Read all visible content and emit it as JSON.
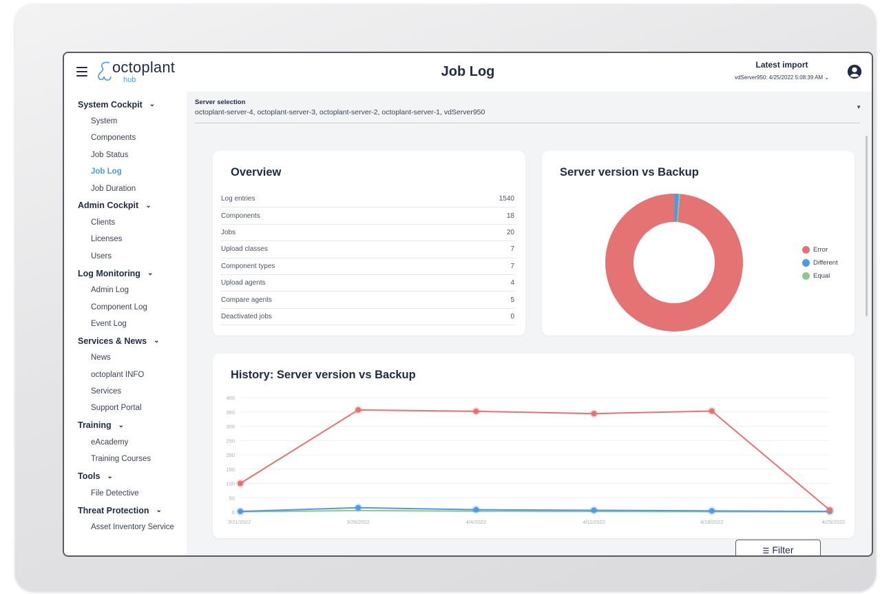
{
  "header": {
    "logo_text": "octoplant",
    "logo_sub": "hub",
    "page_title": "Job Log",
    "latest_import_label": "Latest import",
    "latest_import_value": "vdServer950: 4/25/2022 5:08:39 AM ⌄",
    "user_icon": "account-circle-icon",
    "menu_icon": "hamburger-menu-icon"
  },
  "sidebar": {
    "sections": [
      {
        "label": "System Cockpit",
        "items": [
          "System",
          "Components",
          "Job Status",
          "Job Log",
          "Job Duration"
        ]
      },
      {
        "label": "Admin Cockpit",
        "items": [
          "Clients",
          "Licenses",
          "Users"
        ]
      },
      {
        "label": "Log Monitoring",
        "items": [
          "Admin Log",
          "Component Log",
          "Event Log"
        ]
      },
      {
        "label": "Services & News",
        "items": [
          "News",
          "octoplant INFO",
          "Services",
          "Support Portal"
        ]
      },
      {
        "label": "Training",
        "items": [
          "eAcademy",
          "Training Courses"
        ]
      },
      {
        "label": "Tools",
        "items": [
          "File Detective"
        ]
      },
      {
        "label": "Threat Protection",
        "items": [
          "Asset Inventory Service"
        ]
      }
    ],
    "active_item": "Job Log",
    "chevron_icon": "chevron-down-icon"
  },
  "server_selection": {
    "label": "Server selection",
    "value": "octoplant-server-4, octoplant-server-3, octoplant-server-2, octoplant-server-1, vdServer950"
  },
  "overview": {
    "title": "Overview",
    "rows": [
      {
        "label": "Log entries",
        "value": "1540"
      },
      {
        "label": "Components",
        "value": "18"
      },
      {
        "label": "Jobs",
        "value": "20"
      },
      {
        "label": "Upload classes",
        "value": "7"
      },
      {
        "label": "Component types",
        "value": "7"
      },
      {
        "label": "Upload agents",
        "value": "4"
      },
      {
        "label": "Compare agents",
        "value": "5"
      },
      {
        "label": "Deactivated jobs",
        "value": "0"
      }
    ]
  },
  "colors": {
    "error": "#e57373",
    "different": "#4d9ae6",
    "equal": "#8fc98f",
    "accent": "#4d9ae6",
    "title": "#1f2a44"
  },
  "filter_button": {
    "label": "Filter",
    "icon": "filter-icon"
  },
  "chart_data": [
    {
      "type": "pie",
      "title": "Server version vs Backup",
      "labels": [
        "Error",
        "Different",
        "Equal"
      ],
      "values": [
        354,
        4,
        1
      ],
      "legend": "right"
    },
    {
      "type": "line",
      "title": "History: Server version vs Backup",
      "x": [
        "3/21/2022",
        "3/28/2022",
        "4/4/2022",
        "4/11/2022",
        "4/18/2022",
        "4/25/2022"
      ],
      "ylim": [
        0,
        400
      ],
      "yticks": [
        0,
        50,
        100,
        150,
        200,
        250,
        300,
        350,
        400
      ],
      "grid": true,
      "series": [
        {
          "name": "Error",
          "values": [
            100,
            357,
            352,
            344,
            353,
            7
          ]
        },
        {
          "name": "Different",
          "values": [
            2,
            15,
            8,
            6,
            4,
            2
          ]
        },
        {
          "name": "Equal",
          "values": [
            1,
            5,
            3,
            2,
            1,
            1
          ]
        }
      ]
    }
  ]
}
